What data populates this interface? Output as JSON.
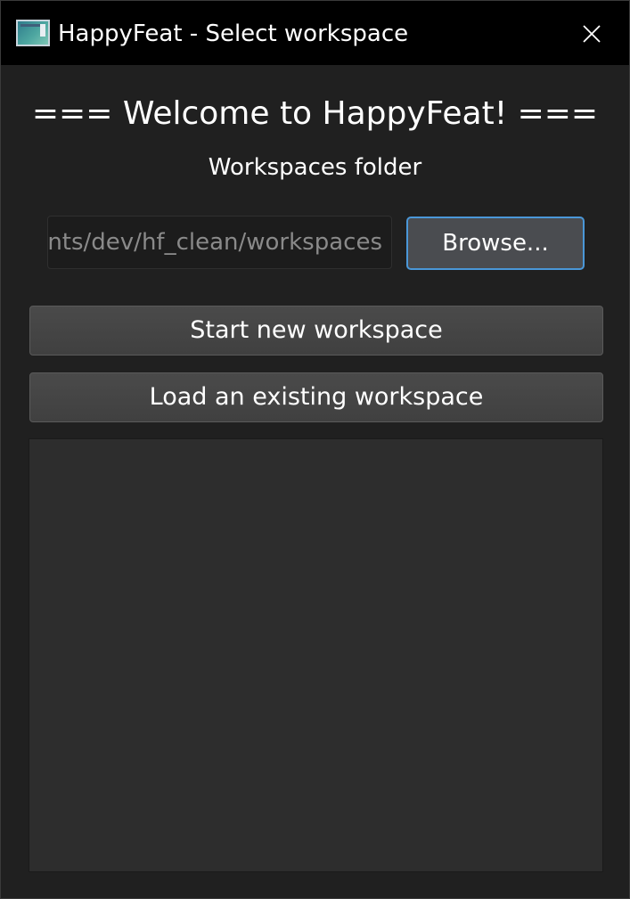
{
  "window": {
    "title": "HappyFeat - Select workspace",
    "icon": "app-icon",
    "close_icon": "close-icon"
  },
  "main": {
    "welcome": "=== Welcome to HappyFeat! ===",
    "folder_label": "Workspaces folder",
    "path_value": "nts/dev/hf_clean/workspaces",
    "browse_label": "Browse...",
    "start_label": "Start new workspace",
    "load_label": "Load an existing workspace",
    "workspaces": []
  },
  "colors": {
    "background": "#202020",
    "titlebar": "#000000",
    "focus_border": "#4a97d8",
    "list_background": "#2d2d2d"
  }
}
